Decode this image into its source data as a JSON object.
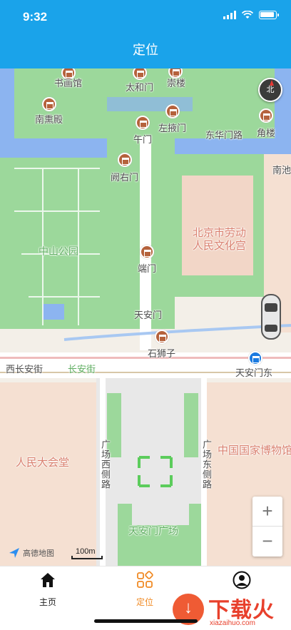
{
  "status_bar": {
    "time": "9:32"
  },
  "nav": {
    "title": "定位"
  },
  "map": {
    "labels": {
      "shuhuaguan": "书画馆",
      "taihemen": "太和门",
      "chonglou": "崇楼",
      "nanxundian": "南熏殿",
      "zuoyemen": "左掖门",
      "wumen": "午门",
      "donghuamen_road": "东华门路",
      "jiaolou": "角楼",
      "queyoumen": "阙右门",
      "nanchi": "南池",
      "workers_palace": "北京市劳动人民文化宫",
      "zhongshan_park": "中山公园",
      "duanmen": "端门",
      "tiananmen": "天安门",
      "shishizi": "石狮子",
      "xichangan": "西长安街",
      "changanjie": "长安街",
      "tiananmen_east": "天安门东",
      "great_hall": "人民大会堂",
      "guangchang_west": "广场西侧路",
      "guangchang_east": "广场东侧路",
      "national_museum": "中国国家博物馆",
      "tiananmen_square": "天安门广场",
      "compass_n": "北"
    },
    "logo_text": "高德地图",
    "scale_text": "100m",
    "zoom_in": "+",
    "zoom_out": "−"
  },
  "tabbar": {
    "home": "主页",
    "locate": "定位"
  },
  "watermark": {
    "text": "下载火",
    "sub": "xiazaihuo.com"
  },
  "colors": {
    "header": "#1aa3ea",
    "park": "#9cd89b",
    "water": "#8cb4f0",
    "tab_active": "#f08a24"
  }
}
